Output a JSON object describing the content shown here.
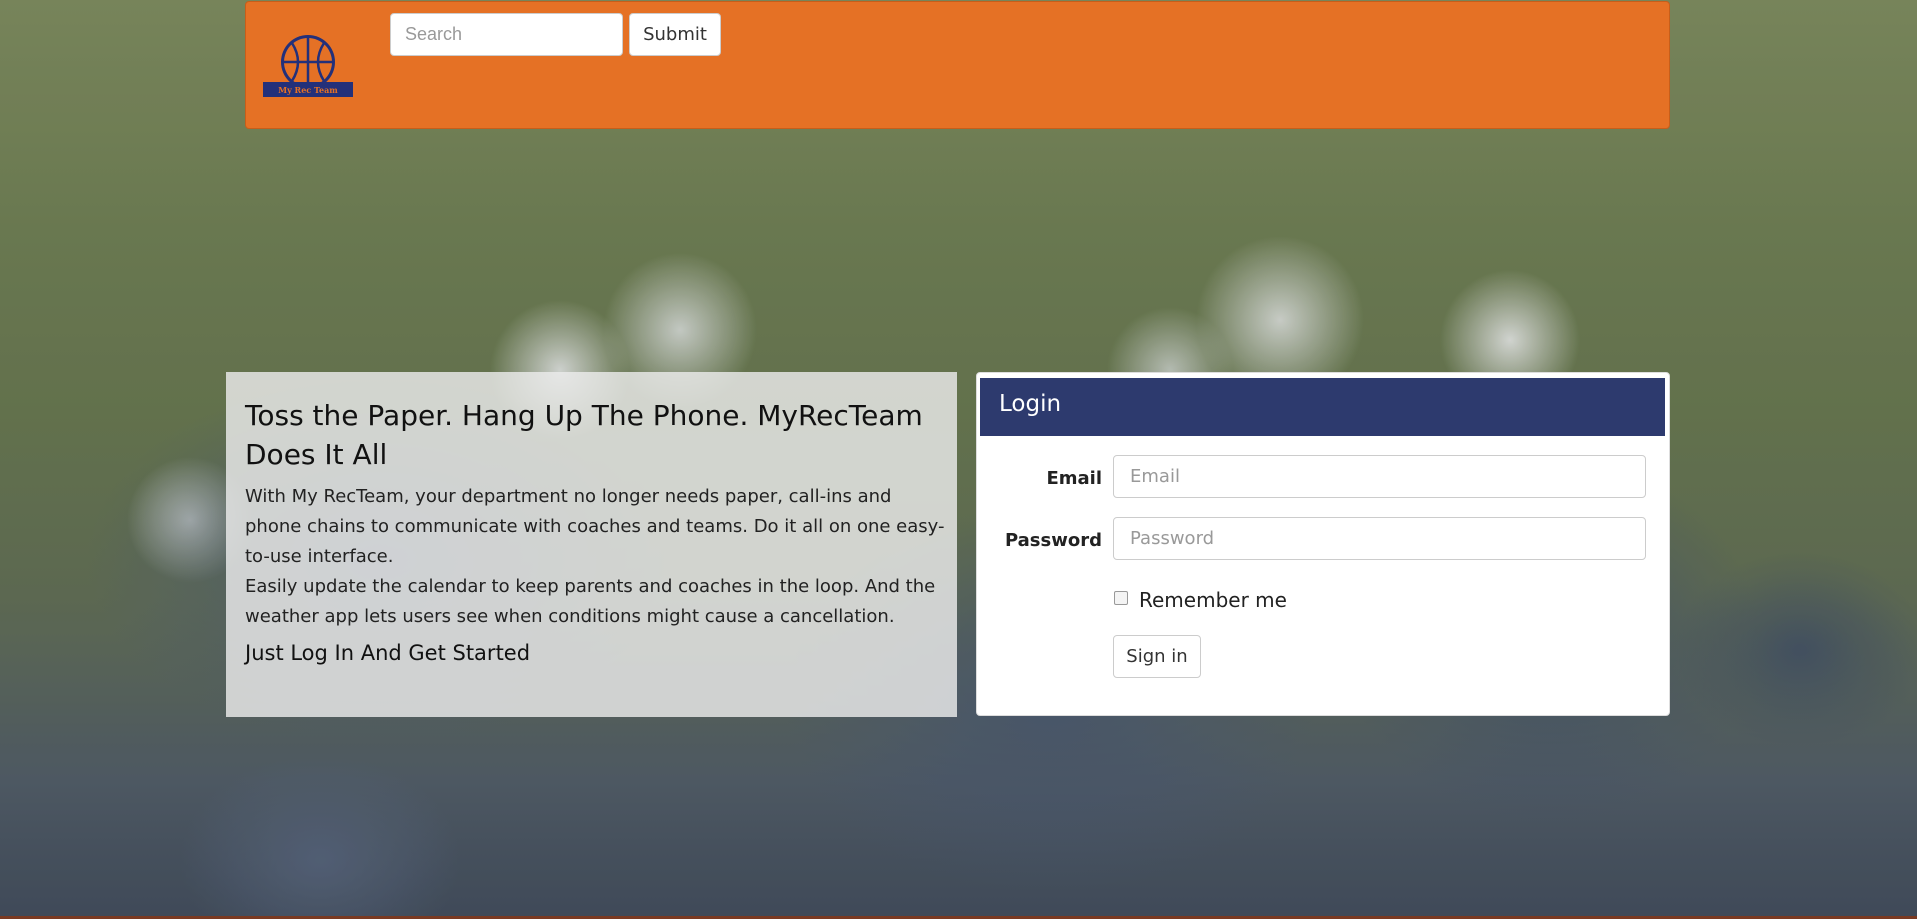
{
  "header": {
    "logo_text": "My Rec Team",
    "search": {
      "placeholder": "Search",
      "value": ""
    },
    "submit_label": "Submit"
  },
  "intro": {
    "headline": "Toss the Paper. Hang Up The Phone. MyRecTeam Does It All",
    "paragraph1": "With My RecTeam, your department no longer needs paper, call-ins and phone chains to communicate with coaches and teams. Do it all on one easy-to-use interface.",
    "paragraph2": "Easily update the calendar to keep parents and coaches in the loop. And the weather app lets users see when conditions might cause a cancellation.",
    "cta": "Just Log In And Get Started"
  },
  "login": {
    "title": "Login",
    "email_label": "Email",
    "email_placeholder": "Email",
    "password_label": "Password",
    "password_placeholder": "Password",
    "remember_label": "Remember me",
    "remember_checked": false,
    "signin_label": "Sign in"
  },
  "colors": {
    "navbar": "#e57125",
    "login_header": "#2d3a6e",
    "logo_blue": "#23307a",
    "logo_orange": "#e57125"
  }
}
